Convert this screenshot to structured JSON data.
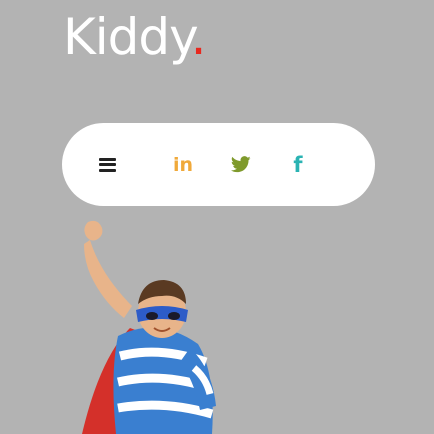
{
  "brand": {
    "name": "Kiddy",
    "dot": ".",
    "accent": "#e8281e"
  },
  "nav": {
    "menu_icon": "hamburger-menu-icon",
    "social": [
      {
        "name": "linkedin",
        "label": "in",
        "icon": "linkedin-icon",
        "color": "#f0a93a"
      },
      {
        "name": "twitter",
        "label": "",
        "icon": "twitter-icon",
        "color": "#7f9a2c"
      },
      {
        "name": "facebook",
        "label": "f",
        "icon": "facebook-icon",
        "color": "#2ab3b3"
      }
    ]
  },
  "colors": {
    "background": "#b3b3b3",
    "pill": "#ffffff"
  },
  "hero": {
    "image": "superhero-kid-image"
  }
}
